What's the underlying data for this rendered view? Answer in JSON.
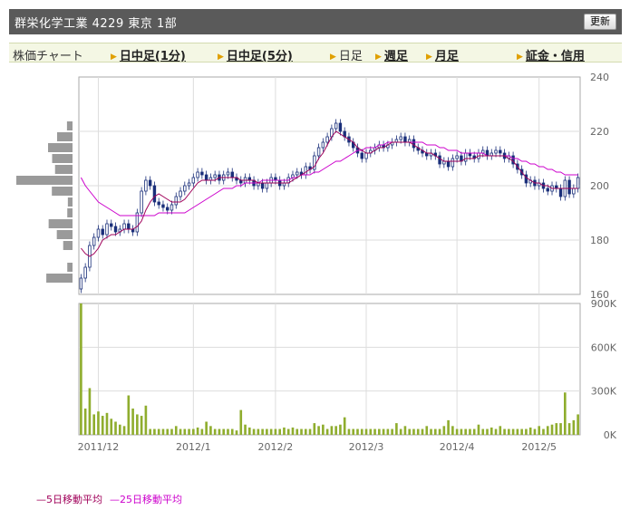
{
  "header": {
    "title": "群栄化学工業 4229 東京 1部",
    "refresh_label": "更新"
  },
  "tabs": [
    {
      "label": "株価チャート",
      "arrow": false,
      "link": false
    },
    {
      "label": "日中足(1分)",
      "arrow": true,
      "link": true
    },
    {
      "label": "日中足(5分)",
      "arrow": true,
      "link": true
    },
    {
      "label": "日足",
      "arrow": true,
      "link": false
    },
    {
      "label": "週足",
      "arrow": true,
      "link": true
    },
    {
      "label": "月足",
      "arrow": true,
      "link": true
    },
    {
      "label": "証金・信用",
      "arrow": true,
      "link": true
    }
  ],
  "legend": [
    {
      "label": "5日移動平均",
      "color": "#a0005a"
    },
    {
      "label": "25日移動平均",
      "color": "#cc00cc"
    }
  ],
  "chart_data": {
    "type": "candlestick",
    "colors": {
      "candle": "#1a2f7a",
      "ma5": "#a0005a",
      "ma25": "#cc00cc",
      "volume": "#8fad2e",
      "grid": "#dddddd"
    },
    "price_axis": {
      "min": 160,
      "max": 240,
      "ticks": [
        160,
        180,
        200,
        220,
        240
      ]
    },
    "volume_axis": {
      "min": 0,
      "max": 900000,
      "ticks": [
        0,
        300000,
        600000,
        900000
      ],
      "tick_labels": [
        "0K",
        "300K",
        "600K",
        "900K"
      ]
    },
    "x_labels": [
      {
        "label": "2011/12",
        "index": 4
      },
      {
        "label": "2012/1",
        "index": 26
      },
      {
        "label": "2012/2",
        "index": 45
      },
      {
        "label": "2012/3",
        "index": 66
      },
      {
        "label": "2012/4",
        "index": 87
      },
      {
        "label": "2012/5",
        "index": 106
      }
    ],
    "close": [
      166,
      170,
      178,
      181,
      184,
      182,
      186,
      185,
      183,
      184,
      186,
      184,
      183,
      190,
      198,
      202,
      200,
      194,
      193,
      192,
      191,
      193,
      196,
      198,
      200,
      201,
      203,
      205,
      204,
      202,
      203,
      204,
      202,
      204,
      205,
      203,
      202,
      201,
      203,
      202,
      200,
      201,
      199,
      201,
      203,
      202,
      200,
      201,
      203,
      204,
      205,
      204,
      207,
      206,
      211,
      214,
      216,
      218,
      221,
      223,
      220,
      218,
      216,
      214,
      212,
      210,
      212,
      213,
      214,
      215,
      214,
      215,
      216,
      217,
      218,
      216,
      217,
      214,
      213,
      212,
      211,
      212,
      211,
      208,
      209,
      207,
      210,
      211,
      209,
      212,
      211,
      210,
      212,
      213,
      211,
      212,
      213,
      212,
      210,
      211,
      208,
      206,
      204,
      201,
      202,
      200,
      201,
      199,
      198,
      200,
      199,
      196,
      202,
      197,
      199,
      203
    ],
    "volume": [
      900000,
      180000,
      320000,
      140000,
      160000,
      130000,
      150000,
      110000,
      90000,
      70000,
      60000,
      270000,
      180000,
      140000,
      130000,
      200000,
      40000,
      40000,
      40000,
      40000,
      40000,
      40000,
      60000,
      40000,
      40000,
      40000,
      40000,
      50000,
      40000,
      90000,
      60000,
      40000,
      40000,
      40000,
      40000,
      40000,
      30000,
      170000,
      70000,
      50000,
      40000,
      40000,
      40000,
      40000,
      40000,
      40000,
      40000,
      50000,
      40000,
      50000,
      40000,
      40000,
      40000,
      40000,
      80000,
      60000,
      70000,
      40000,
      60000,
      60000,
      70000,
      120000,
      40000,
      40000,
      40000,
      40000,
      40000,
      40000,
      40000,
      40000,
      40000,
      40000,
      40000,
      80000,
      40000,
      60000,
      40000,
      40000,
      40000,
      40000,
      60000,
      40000,
      40000,
      40000,
      60000,
      100000,
      60000,
      40000,
      40000,
      40000,
      40000,
      40000,
      70000,
      40000,
      40000,
      50000,
      40000,
      60000,
      40000,
      40000,
      40000,
      40000,
      40000,
      40000,
      50000,
      40000,
      60000,
      40000,
      60000,
      70000,
      80000,
      80000,
      290000,
      80000,
      100000,
      140000
    ],
    "ma5": [
      177,
      175,
      174,
      175,
      177,
      180,
      181,
      182,
      182,
      183,
      184,
      184,
      184,
      185,
      187,
      191,
      194,
      196,
      197,
      196,
      195,
      194,
      194,
      194,
      195,
      197,
      199,
      201,
      202,
      202,
      202,
      202,
      203,
      203,
      203,
      203,
      203,
      202,
      202,
      202,
      202,
      201,
      201,
      201,
      201,
      201,
      201,
      201,
      201,
      202,
      203,
      204,
      205,
      206,
      207,
      210,
      212,
      215,
      218,
      220,
      219,
      218,
      217,
      216,
      214,
      213,
      212,
      212,
      213,
      214,
      214,
      215,
      216,
      216,
      216,
      216,
      216,
      215,
      214,
      213,
      212,
      212,
      211,
      210,
      209,
      209,
      209,
      209,
      209,
      210,
      210,
      210,
      211,
      211,
      211,
      211,
      211,
      211,
      211,
      210,
      209,
      207,
      205,
      203,
      202,
      201,
      201,
      200,
      200,
      199,
      199,
      199,
      199,
      199,
      199,
      199
    ],
    "ma25": [
      203,
      200,
      198,
      196,
      194,
      193,
      192,
      191,
      190,
      189,
      189,
      189,
      189,
      189,
      189,
      189,
      189,
      189,
      190,
      190,
      190,
      190,
      190,
      190,
      190,
      191,
      192,
      193,
      194,
      195,
      196,
      197,
      198,
      199,
      199,
      199,
      200,
      200,
      201,
      201,
      201,
      201,
      202,
      202,
      202,
      202,
      202,
      202,
      202,
      203,
      203,
      204,
      204,
      204,
      205,
      205,
      206,
      207,
      208,
      209,
      209,
      210,
      211,
      212,
      213,
      213,
      214,
      214,
      214,
      215,
      215,
      216,
      216,
      216,
      216,
      216,
      216,
      216,
      216,
      216,
      215,
      215,
      215,
      214,
      214,
      213,
      213,
      213,
      212,
      212,
      212,
      212,
      212,
      212,
      211,
      211,
      211,
      211,
      211,
      211,
      210,
      210,
      209,
      209,
      208,
      208,
      207,
      207,
      206,
      206,
      205,
      205,
      204,
      204,
      204,
      204
    ]
  }
}
